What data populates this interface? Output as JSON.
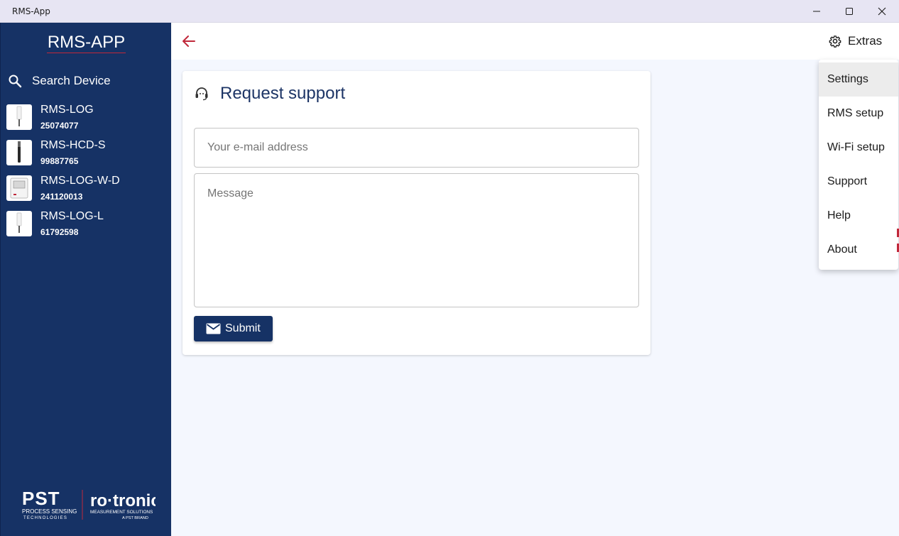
{
  "window": {
    "title": "RMS-App"
  },
  "sidebar": {
    "brand": "RMS-APP",
    "search_label": "Search Device",
    "devices": [
      {
        "name": "RMS-LOG",
        "serial": "25074077",
        "icon": "stick-sensor-icon"
      },
      {
        "name": "RMS-HCD-S",
        "serial": "99887765",
        "icon": "probe-sensor-icon"
      },
      {
        "name": "RMS-LOG-W-D",
        "serial": "241120013",
        "icon": "display-logger-icon"
      },
      {
        "name": "RMS-LOG-L",
        "serial": "61792598",
        "icon": "stick-sensor-icon"
      }
    ],
    "footer_logos": {
      "pst": "PST",
      "pst_sub1": "PROCESS SENSING",
      "pst_sub2": "TECHNOLOGIES",
      "rotronic": "ro·tronic",
      "rotronic_sub1": "MEASUREMENT SOLUTIONS",
      "rotronic_sub2": "A PST BRAND"
    }
  },
  "topbar": {
    "extras_label": "Extras"
  },
  "support_form": {
    "title": "Request support",
    "email_placeholder": "Your e-mail address",
    "email_value": "",
    "message_placeholder": "Message",
    "message_value": "",
    "submit_label": "Submit"
  },
  "extras_menu": {
    "items": [
      {
        "label": "Settings",
        "active": true
      },
      {
        "label": "RMS setup"
      },
      {
        "label": "Wi-Fi setup"
      },
      {
        "label": "Support"
      },
      {
        "label": "Help"
      },
      {
        "label": "About"
      }
    ]
  },
  "colors": {
    "sidebar_bg": "#163265",
    "accent_red": "#c0283a",
    "title_text": "#1d3566",
    "main_bg": "#f4f7fe"
  }
}
